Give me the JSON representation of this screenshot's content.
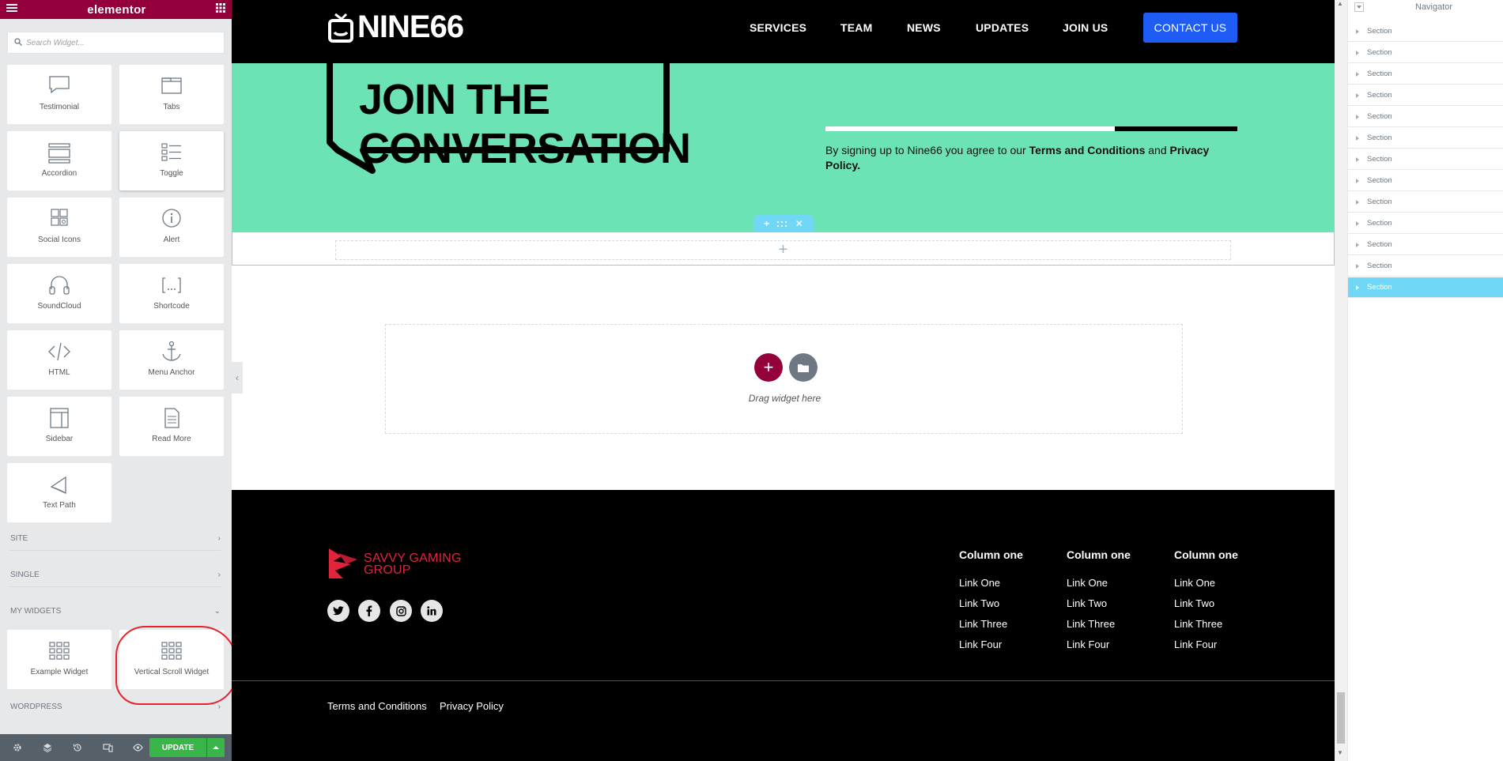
{
  "editor": {
    "brand": "elementor",
    "search_placeholder": "Search Widget...",
    "widgets": [
      {
        "label": "Testimonial",
        "icon": "testimonial-icon"
      },
      {
        "label": "Tabs",
        "icon": "tabs-icon"
      },
      {
        "label": "Accordion",
        "icon": "accordion-icon"
      },
      {
        "label": "Toggle",
        "icon": "toggle-icon"
      },
      {
        "label": "Social Icons",
        "icon": "social-icons-icon"
      },
      {
        "label": "Alert",
        "icon": "alert-icon"
      },
      {
        "label": "SoundCloud",
        "icon": "soundcloud-icon"
      },
      {
        "label": "Shortcode",
        "icon": "shortcode-icon"
      },
      {
        "label": "HTML",
        "icon": "html-icon"
      },
      {
        "label": "Menu Anchor",
        "icon": "anchor-icon"
      },
      {
        "label": "Sidebar",
        "icon": "sidebar-icon"
      },
      {
        "label": "Read More",
        "icon": "read-more-icon"
      },
      {
        "label": "Text Path",
        "icon": "text-path-icon"
      }
    ],
    "categories": {
      "site": "SITE",
      "single": "SINGLE",
      "my_widgets": "MY WIDGETS",
      "wordpress": "WORDPRESS"
    },
    "my_widgets": [
      {
        "label": "Example Widget",
        "icon": "grid-icon"
      },
      {
        "label": "Vertical Scroll Widget",
        "icon": "grid-icon"
      }
    ],
    "update_label": "UPDATE"
  },
  "site": {
    "logo": "NINE66",
    "nav": [
      "SERVICES",
      "TEAM",
      "NEWS",
      "UPDATES",
      "JOIN US"
    ],
    "cta": "CONTACT US",
    "hero": {
      "line1": "JOIN THE",
      "line2": "CONVERSATION",
      "signup_prefix": "By signing up to Nine66 you agree to our ",
      "terms": "Terms and Conditions",
      "and": " and ",
      "privacy": "Privacy Policy",
      "suffix": "."
    },
    "drop_zone_text": "Drag widget here",
    "footer": {
      "brand_line1": "SAVVY GAMING",
      "brand_line2": "GROUP",
      "socials": [
        "twitter-icon",
        "facebook-icon",
        "instagram-icon",
        "linkedin-icon"
      ],
      "columns": [
        {
          "heading": "Column one",
          "links": [
            "Link One",
            "Link Two",
            "Link Three",
            "Link Four"
          ]
        },
        {
          "heading": "Column one",
          "links": [
            "Link One",
            "Link Two",
            "Link Three",
            "Link Four"
          ]
        },
        {
          "heading": "Column one",
          "links": [
            "Link One",
            "Link Two",
            "Link Three",
            "Link Four"
          ]
        }
      ],
      "legal": [
        "Terms and Conditions",
        "Privacy Policy"
      ]
    }
  },
  "navigator": {
    "title": "Navigator",
    "items": [
      "Section",
      "Section",
      "Section",
      "Section",
      "Section",
      "Section",
      "Section",
      "Section",
      "Section",
      "Section",
      "Section",
      "Section",
      "Section"
    ],
    "active_index": 12
  },
  "colors": {
    "elementor_brand": "#93003c",
    "hero_green": "#6ce3b5",
    "cta_blue": "#1e5cf5",
    "update_green": "#39b54a",
    "navigator_active": "#71d7f7",
    "footer_brand_red": "#e0243c",
    "annotation_red": "#e8222a"
  }
}
